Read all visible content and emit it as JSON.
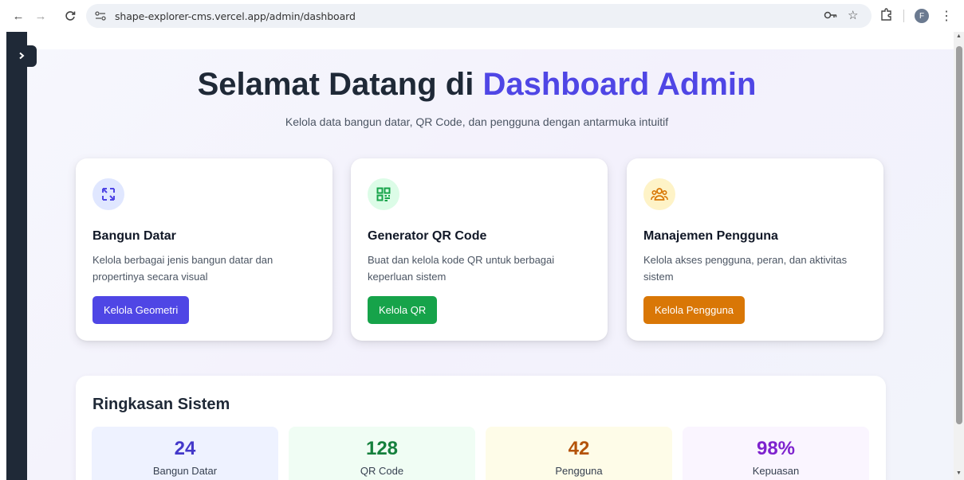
{
  "browser": {
    "url": "shape-explorer-cms.vercel.app/admin/dashboard",
    "profile_initial": "F"
  },
  "hero": {
    "title_prefix": "Selamat Datang di ",
    "title_accent": "Dashboard Admin",
    "subtitle": "Kelola data bangun datar, QR Code, dan pengguna dengan antarmuka intuitif"
  },
  "cards": [
    {
      "icon": "shapes-icon",
      "title": "Bangun Datar",
      "description": "Kelola berbagai jenis bangun datar dan propertinya secara visual",
      "button": "Kelola Geometri",
      "color": "#4f46e5",
      "icon_bg": "#e0e7ff"
    },
    {
      "icon": "qr-code-icon",
      "title": "Generator QR Code",
      "description": "Buat dan kelola kode QR untuk berbagai keperluan sistem",
      "button": "Kelola QR",
      "color": "#16a34a",
      "icon_bg": "#dcfce7"
    },
    {
      "icon": "users-icon",
      "title": "Manajemen Pengguna",
      "description": "Kelola akses pengguna, peran, dan aktivitas sistem",
      "button": "Kelola Pengguna",
      "color": "#d97706",
      "icon_bg": "#fef3c7"
    }
  ],
  "summary": {
    "title": "Ringkasan Sistem",
    "stats": [
      {
        "value": "24",
        "label": "Bangun Datar",
        "color": "#4338ca",
        "bg": "#eef2ff"
      },
      {
        "value": "128",
        "label": "QR Code",
        "color": "#15803d",
        "bg": "#f0fdf4"
      },
      {
        "value": "42",
        "label": "Pengguna",
        "color": "#b45309",
        "bg": "#fefce8"
      },
      {
        "value": "98%",
        "label": "Kepuasan",
        "color": "#7e22ce",
        "bg": "#faf5ff"
      }
    ]
  }
}
